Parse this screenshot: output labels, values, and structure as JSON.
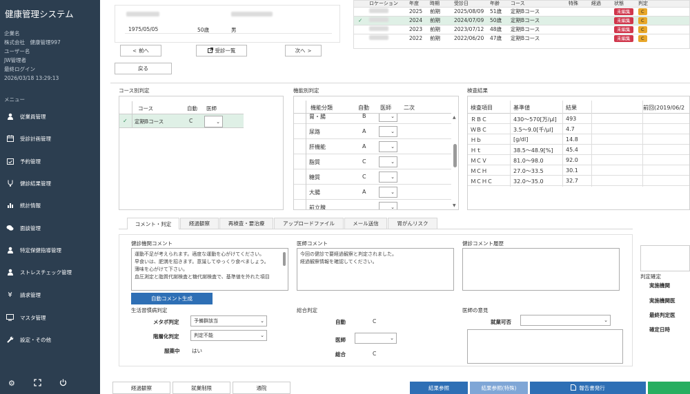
{
  "app": {
    "title": "健康管理システム"
  },
  "user_info": {
    "company_label": "企業名",
    "company": "株式会社　健康管理997",
    "user_label": "ユーザー名",
    "user": "JW管理者",
    "last_login_label": "最終ログイン",
    "last_login": "2026/03/18 13:29:13"
  },
  "menu": {
    "heading": "メニュー",
    "items": [
      {
        "label": "従業員管理",
        "icon": "user-icon"
      },
      {
        "label": "受診計画管理",
        "icon": "calendar-icon"
      },
      {
        "label": "予約管理",
        "icon": "calendar-check-icon"
      },
      {
        "label": "健診結果管理",
        "icon": "stethoscope-icon"
      },
      {
        "label": "統計情報",
        "icon": "bar-chart-icon"
      },
      {
        "label": "面談管理",
        "icon": "chat-icon"
      },
      {
        "label": "特定保健指導管理",
        "icon": "user-icon"
      },
      {
        "label": "ストレスチェック管理",
        "icon": "user-icon"
      },
      {
        "label": "請求管理",
        "icon": "yen-icon"
      },
      {
        "label": "マスタ管理",
        "icon": "monitor-icon"
      },
      {
        "label": "設定・その他",
        "icon": "wrench-icon"
      }
    ],
    "bottom_icons": [
      "gear-icon",
      "expand-icon",
      "power-icon"
    ]
  },
  "patient": {
    "birthdate": "1975/05/05",
    "age": "50歳",
    "sex": "男"
  },
  "nav": {
    "prev": "前へ",
    "list": "受診一覧",
    "next": "次へ",
    "back": "戻る"
  },
  "history": {
    "headers": [
      "ロケーション",
      "年度",
      "時期",
      "受診日",
      "年齢",
      "コース",
      "特殊",
      "経過",
      "状態",
      "判定"
    ],
    "rows": [
      {
        "year": "2025",
        "period": "前期",
        "date": "2025/08/09",
        "age": "51歳",
        "course": "定期Bコース",
        "status": "未編集",
        "judge": "C",
        "selected": false
      },
      {
        "year": "2024",
        "period": "前期",
        "date": "2024/07/09",
        "age": "50歳",
        "course": "定期Bコース",
        "status": "未編集",
        "judge": "C",
        "selected": true
      },
      {
        "year": "2023",
        "period": "前期",
        "date": "2023/07/12",
        "age": "48歳",
        "course": "定期Bコース",
        "status": "未編集",
        "judge": "C",
        "selected": false
      },
      {
        "year": "2022",
        "period": "前期",
        "date": "2022/06/20",
        "age": "47歳",
        "course": "定期Bコース",
        "status": "未編集",
        "judge": "C",
        "selected": false
      }
    ]
  },
  "course_judgement": {
    "title": "コース別判定",
    "headers": [
      "コース",
      "自動",
      "医師"
    ],
    "rows": [
      {
        "course": "定期Bコース",
        "auto": "C"
      }
    ]
  },
  "function_judgement": {
    "title": "機能別判定",
    "headers": [
      "機能分類",
      "自動",
      "医師",
      "二次"
    ],
    "rows": [
      {
        "name": "胃・腸",
        "auto": "B"
      },
      {
        "name": "尿路",
        "auto": "A"
      },
      {
        "name": "肝機能",
        "auto": "A"
      },
      {
        "name": "脂質",
        "auto": "C"
      },
      {
        "name": "糖質",
        "auto": "C"
      },
      {
        "name": "大腸",
        "auto": "A"
      },
      {
        "name": "前立腺",
        "auto": ""
      }
    ]
  },
  "exam_results": {
    "title": "検査結果",
    "headers": [
      "検査項目",
      "基準値",
      "結果",
      "前回(2019/06/2"
    ],
    "rows": [
      {
        "item": "ＲＢＣ",
        "ref": "430〜570[万/μl]",
        "value": "493"
      },
      {
        "item": "ＷＢＣ",
        "ref": "3.5〜9.0[千/μl]",
        "value": "4.7"
      },
      {
        "item": "Ｈｂ",
        "ref": "[g/dl]",
        "value": "14.8"
      },
      {
        "item": "Ｈｔ",
        "ref": "38.5〜48.9[%]",
        "value": "45.4"
      },
      {
        "item": "ＭＣＶ",
        "ref": "81.0〜98.0",
        "value": "92.0"
      },
      {
        "item": "ＭＣＨ",
        "ref": "27.0〜33.5",
        "value": "30.1"
      },
      {
        "item": "ＭＣＨＣ",
        "ref": "32.0〜35.0",
        "value": "32.7"
      }
    ]
  },
  "tabs": [
    "コメント・判定",
    "経過観察",
    "再検査・要治療",
    "アップロードファイル",
    "メール送信",
    "胃がんリスク"
  ],
  "comments": {
    "org_label": "健診機関コメント",
    "org_text": "運動不足が考えられます。適度な運動を心がけてください。\n早食いは、肥満を招きます。意識してゆっくり食べましょう。\n薄味を心がけて下さい。\n血圧測定と脂質代謝検査と糖代謝検査で、基準値を外れた項目",
    "doctor_label": "医師コメント",
    "doctor_text": "今回の健診で要経過観察と判定されました。\n経過観察情報を確認してください。",
    "history_label": "健診コメント履歴",
    "auto_button": "自動コメント生成"
  },
  "lifestyle": {
    "title": "生活習慣病判定",
    "metabo_label": "メタボ判定",
    "metabo_value": "予備群該当",
    "stage_label": "階層化判定",
    "stage_value": "判定不能",
    "med_label": "服薬中",
    "med_value": "はい"
  },
  "overall": {
    "title": "総合判定",
    "auto_label": "自動",
    "auto_value": "C",
    "doctor_label": "医師",
    "combined_label": "総合",
    "combined_value": "C"
  },
  "opinion": {
    "title": "医師の意見",
    "work_label": "就業可否"
  },
  "confirm": {
    "title": "判定確定",
    "org": "実施機関",
    "org_doctor": "実施機関医",
    "final_doctor": "最終判定医",
    "datetime": "確定日時"
  },
  "bottom": {
    "observe": "経過観察",
    "limit": "就業制限",
    "visit": "通院",
    "result_ref": "結果参照",
    "result_ref_special": "結果参照(特殊)",
    "report": "報告書発行"
  }
}
